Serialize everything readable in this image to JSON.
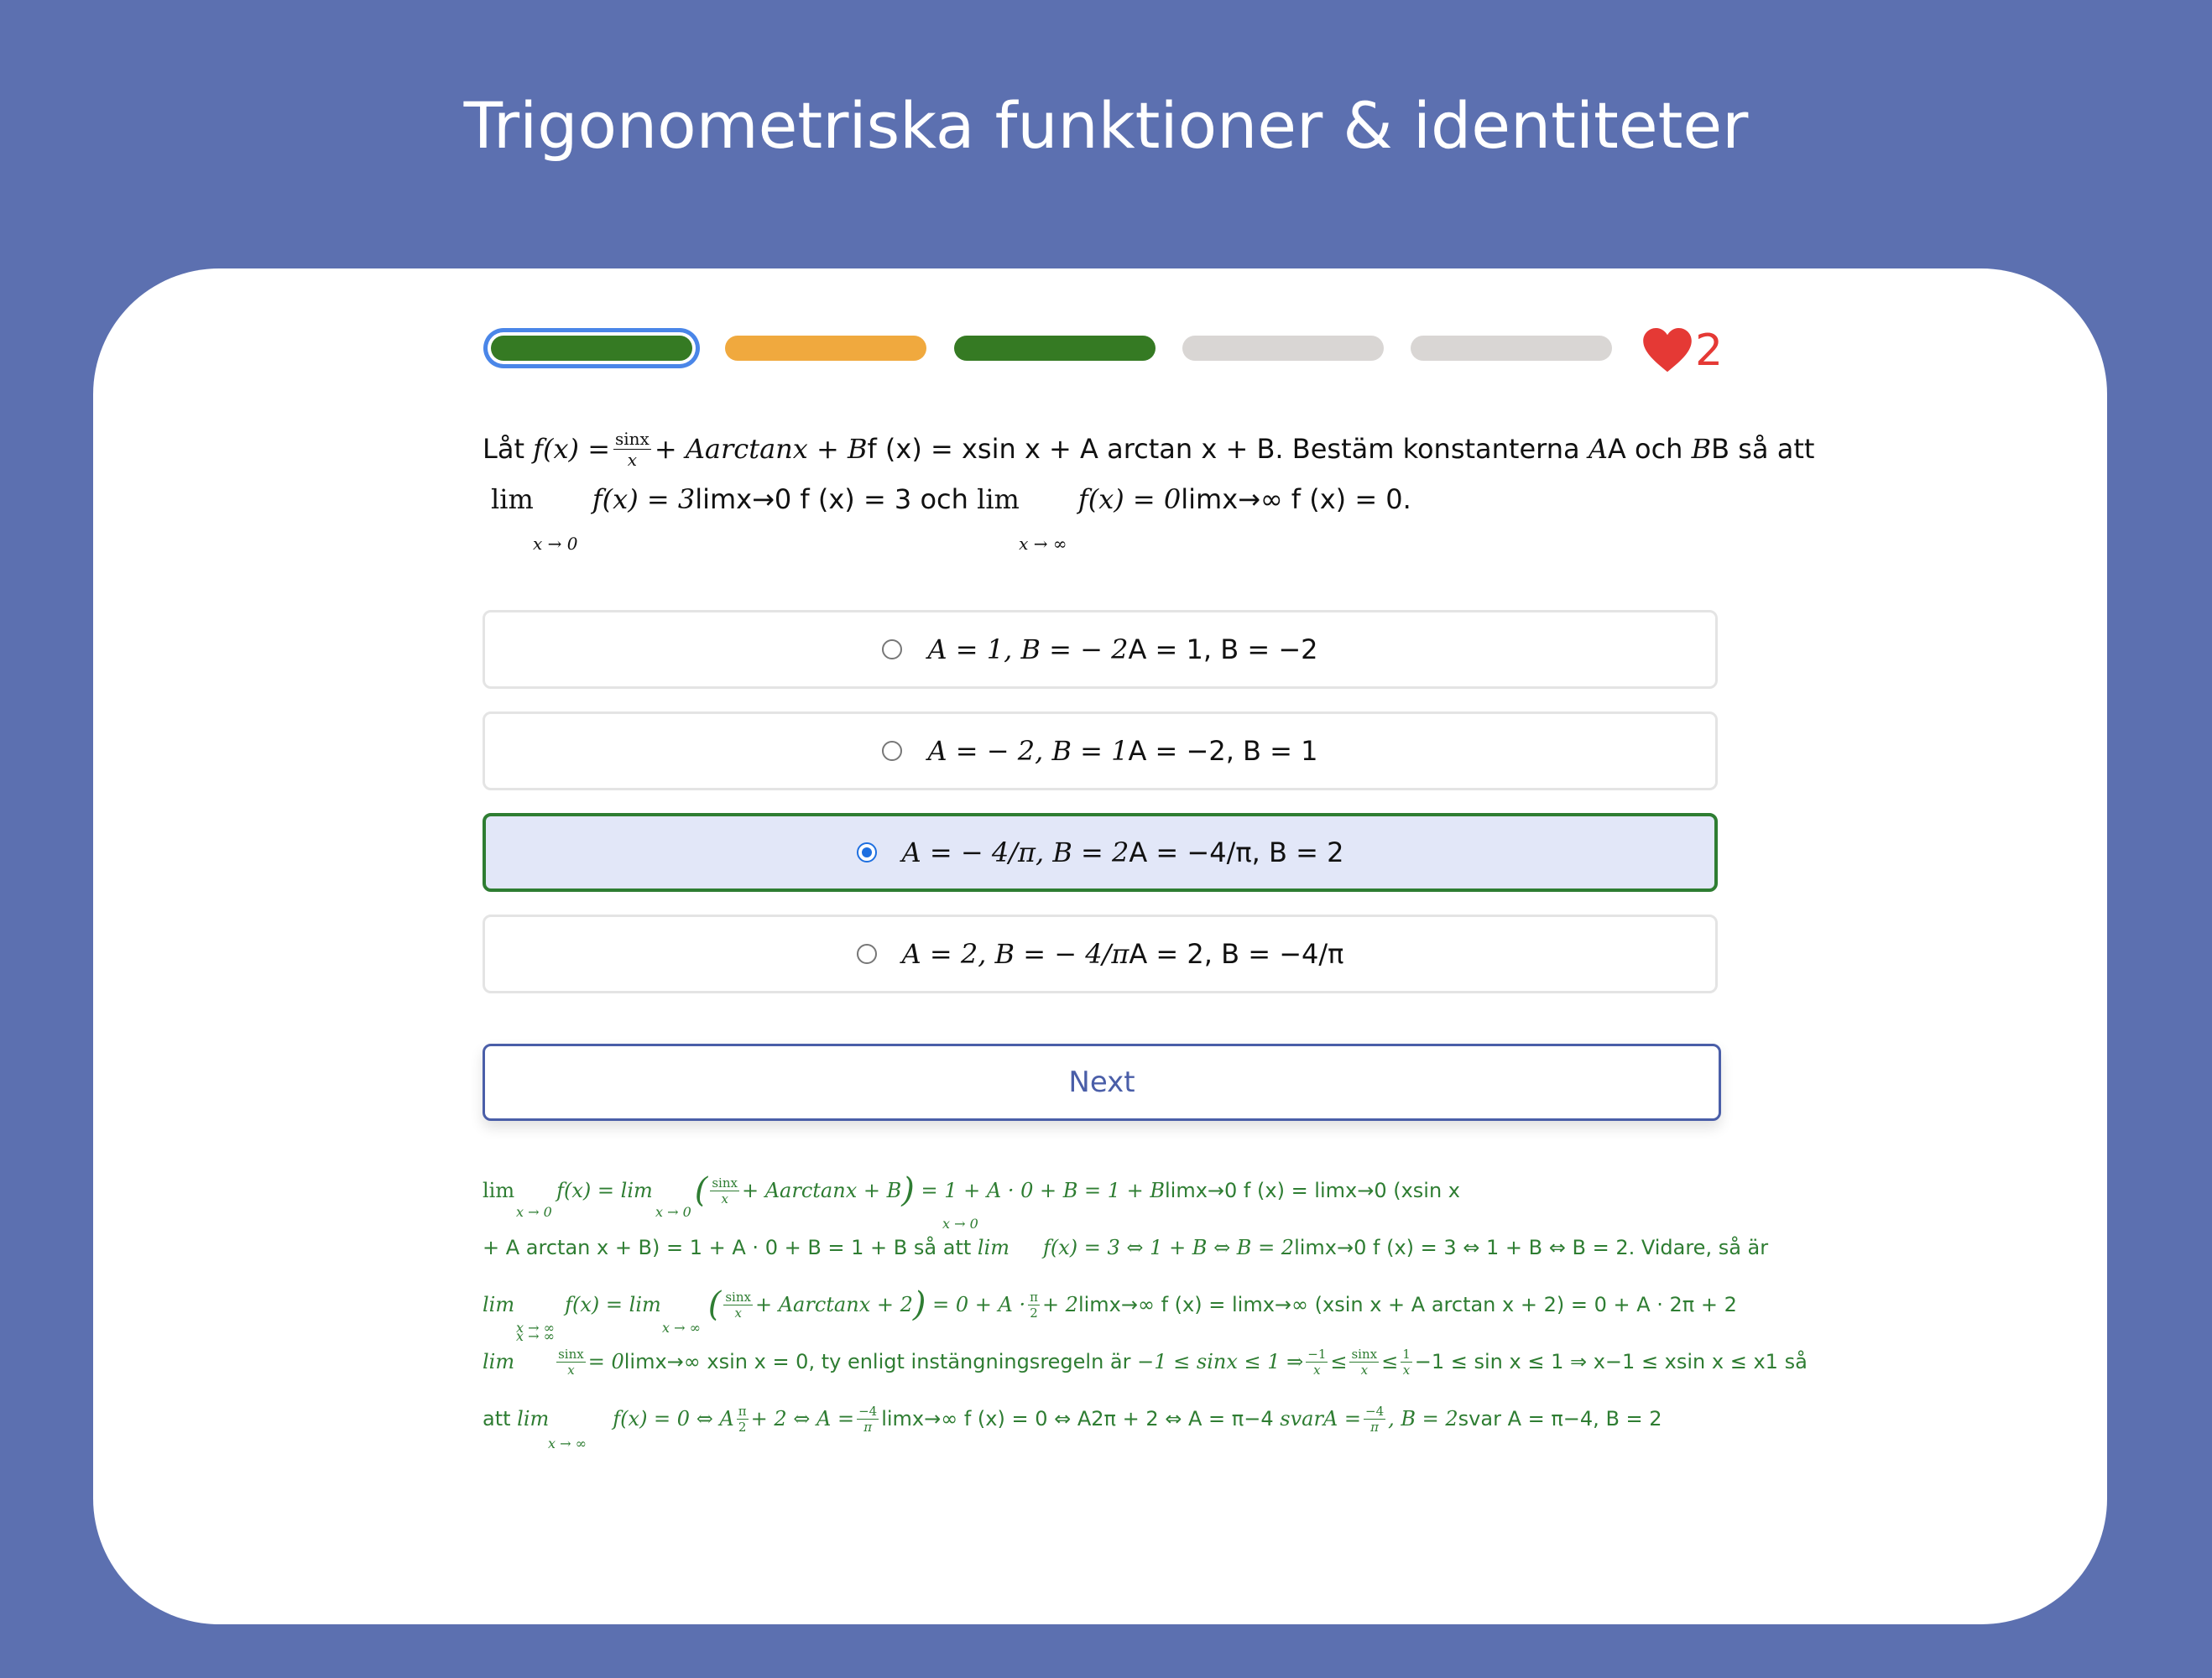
{
  "page": {
    "title": "Trigonometriska funktioner & identiteter"
  },
  "progress": {
    "segments": [
      {
        "status": "correct",
        "color": "#357a23",
        "current": true
      },
      {
        "status": "partial",
        "color": "#f0a93e",
        "current": false
      },
      {
        "status": "correct",
        "color": "#357a23",
        "current": false
      },
      {
        "status": "pending",
        "color": "#d9d6d4",
        "current": false
      },
      {
        "status": "pending",
        "color": "#d9d6d4",
        "current": false
      }
    ],
    "lives_icon": "heart-icon",
    "lives": "2",
    "lives_color": "#e53935"
  },
  "question": {
    "prefix": "Låt",
    "f_lhs": "f(x) =",
    "frac_num": "sinx",
    "frac_den": "x",
    "f_rhs_math": "+ Aarctanx + B",
    "f_plain": "f (x) = xsin x + A arctan x + B. Bestäm konstanterna",
    "A_math": "A",
    "A_plain": "A och",
    "B_math": "B",
    "B_plain": "B så att",
    "lim1_word": "lim",
    "lim1_sub": "x → 0",
    "lim1_math": "f(x) = 3",
    "lim1_plain": "limx→0 f (x) = 3 och",
    "lim2_word": "lim",
    "lim2_sub": "x → ∞",
    "lim2_math": "f(x) = 0",
    "lim2_plain": "limx→∞ f (x) = 0."
  },
  "options": [
    {
      "math": "A = 1, B = − 2",
      "plain": "A = 1, B = −2",
      "selected": false
    },
    {
      "math": "A = − 2, B = 1",
      "plain": "A = −2, B = 1",
      "selected": false
    },
    {
      "math": "A = − 4/π, B = 2",
      "plain": "A = −4/π, B = 2",
      "selected": true
    },
    {
      "math": "A = 2, B = − 4/π",
      "plain": "A = 2, B = −4/π",
      "selected": false
    }
  ],
  "next_label": "Next",
  "solution": {
    "line1": {
      "lim_a": "lim",
      "sub_a": "x → 0",
      "fx": "f(x) =",
      "lim_b": "lim",
      "sub_b": "x → 0",
      "paren_open": "(",
      "frac_num": "sinx",
      "frac_den": "x",
      "mid": "+ Aarctanx + B",
      "paren_close": ")",
      "tail_math": "= 1 + A · 0 + B = 1 + B",
      "tail_plain": "limx→0 f (x) = limx→0 (xsin x"
    },
    "line2": {
      "plain": "+ A arctan x + B) = 1 + A · 0 + B = 1 + B så att",
      "lim": "lim",
      "sub": "x → 0",
      "math": "f(x) = 3 ⇔ 1 + B ⇔ B = 2",
      "plain2": "limx→0 f (x) = 3 ⇔ 1 + B ⇔ B = 2. Vidare, så är"
    },
    "line3": {
      "lim_a": "lim",
      "sub_a": "x → ∞",
      "fx": "f(x) =",
      "lim_b": "lim",
      "sub_b": "x → ∞",
      "paren_open": "(",
      "frac_num": "sinx",
      "frac_den": "x",
      "mid": "+ Aarctanx + 2",
      "paren_close": ")",
      "eq": "= 0 + A ·",
      "pi_num": "π",
      "pi_den": "2",
      "tail_math": "+ 2",
      "tail_plain": "limx→∞ f (x) = limx→∞ (xsin x + A arctan x + 2) = 0 + A · 2π + 2"
    },
    "line4": {
      "lim": "lim",
      "sub": "x → ∞",
      "frac_num": "sinx",
      "frac_den": "x",
      "eq": "= 0",
      "plain": "limx→∞ xsin x = 0, ty enligt instängningsregeln är",
      "ineq_a": "−1 ≤ sinx ≤ 1 ⇒",
      "f1_num": "−1",
      "f1_den": "x",
      "le1": "≤",
      "f2_num": "sinx",
      "f2_den": "x",
      "le2": "≤",
      "f3_num": "1",
      "f3_den": "x",
      "tail_plain": "−1 ≤ sin x ≤ 1 ⇒ x−1 ≤ xsin x ≤ x1 så"
    },
    "line5": {
      "att": "att",
      "lim": "lim",
      "sub": "x → ∞",
      "math_a": "f(x) = 0 ⇔ A",
      "pi_num": "π",
      "pi_den": "2",
      "math_b": "+ 2 ⇔ A =",
      "f_num": "−4",
      "f_den": "π",
      "plain": "limx→∞ f (x) = 0 ⇔ A2π + 2 ⇔ A = π−4",
      "svar_math": "svarA =",
      "s_num": "−4",
      "s_den": "π",
      "svar_tail": ", B = 2",
      "svar_plain": "svar A = π−4, B = 2"
    }
  }
}
